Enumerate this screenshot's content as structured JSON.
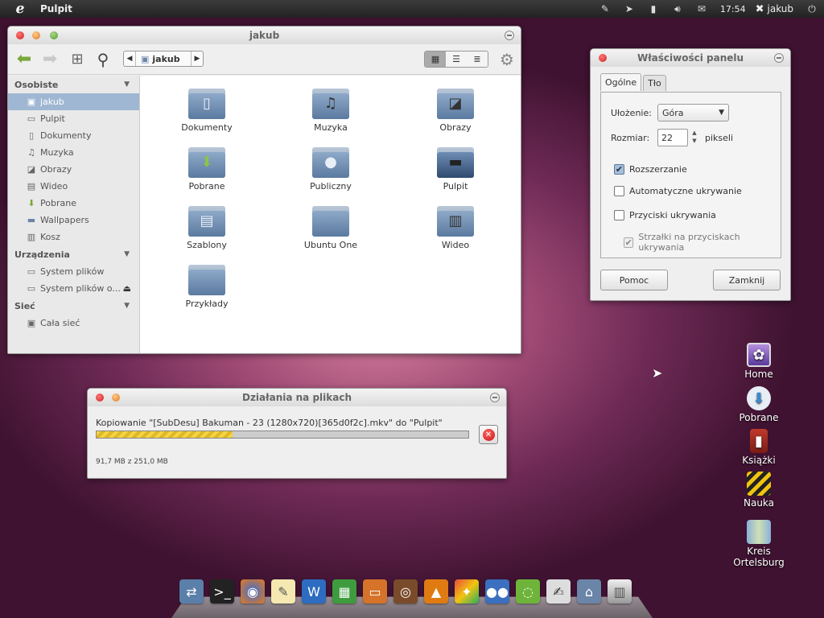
{
  "topbar": {
    "app_name": "Pulpit",
    "clock": "17:54",
    "user": "jakub"
  },
  "file_manager": {
    "title": "jakub",
    "path": {
      "crumb": "jakub"
    },
    "sidebar": {
      "sections": [
        {
          "label": "Osobiste",
          "items": [
            {
              "label": "jakub",
              "icon": "home-folder-icon",
              "selected": true
            },
            {
              "label": "Pulpit",
              "icon": "desktop-icon"
            },
            {
              "label": "Dokumenty",
              "icon": "document-icon"
            },
            {
              "label": "Muzyka",
              "icon": "music-icon"
            },
            {
              "label": "Obrazy",
              "icon": "picture-icon"
            },
            {
              "label": "Wideo",
              "icon": "film-icon"
            },
            {
              "label": "Pobrane",
              "icon": "download-icon"
            },
            {
              "label": "Wallpapers",
              "icon": "folder-icon"
            },
            {
              "label": "Kosz",
              "icon": "trash-icon"
            }
          ]
        },
        {
          "label": "Urządzenia",
          "items": [
            {
              "label": "System plików",
              "icon": "drive-icon"
            },
            {
              "label": "System plików o...",
              "icon": "drive-icon"
            }
          ]
        },
        {
          "label": "Sieć",
          "items": [
            {
              "label": "Cała sieć",
              "icon": "network-icon"
            }
          ]
        }
      ]
    },
    "folders": [
      {
        "label": "Dokumenty",
        "emblem": "document"
      },
      {
        "label": "Muzyka",
        "emblem": "music"
      },
      {
        "label": "Obrazy",
        "emblem": "picture"
      },
      {
        "label": "Pobrane",
        "emblem": "download"
      },
      {
        "label": "Publiczny",
        "emblem": "person"
      },
      {
        "label": "Pulpit",
        "emblem": "desktop"
      },
      {
        "label": "Szablony",
        "emblem": "template"
      },
      {
        "label": "Ubuntu One",
        "emblem": "none"
      },
      {
        "label": "Wideo",
        "emblem": "film"
      },
      {
        "label": "Przykłady",
        "emblem": "none"
      }
    ]
  },
  "panel_dialog": {
    "title": "Właściwości panelu",
    "tabs": [
      "Ogólne",
      "Tło"
    ],
    "placement_label": "Ułożenie:",
    "placement_value": "Góra",
    "size_label": "Rozmiar:",
    "size_value": "22",
    "size_unit": "pikseli",
    "checkboxes": [
      {
        "label": "Rozszerzanie",
        "checked": true,
        "enabled": true
      },
      {
        "label": "Automatyczne ukrywanie",
        "checked": false,
        "enabled": true
      },
      {
        "label": "Przyciski ukrywania",
        "checked": false,
        "enabled": true
      },
      {
        "label": "Strzałki na przyciskach ukrywania",
        "checked": true,
        "enabled": false
      }
    ],
    "help_button": "Pomoc",
    "close_button": "Zamknij"
  },
  "file_ops": {
    "title": "Działania na plikach",
    "message": "Kopiowanie \"[SubDesu] Bakuman - 23 (1280x720)[365d0f2c].mkv\" do \"Pulpit\"",
    "progress": 0.365,
    "progress_text": "91,7 MB z 251,0 MB"
  },
  "desktop_icons": [
    {
      "label": "Home",
      "icon": "monitor-icon"
    },
    {
      "label": "Pobrane",
      "icon": "cloud-download-icon"
    },
    {
      "label": "Książki",
      "icon": "book-icon"
    },
    {
      "label": "Nauka",
      "icon": "barrier-icon"
    },
    {
      "label": "Kreis Ortelsburg",
      "icon": "map-icon"
    }
  ],
  "dock": [
    "network-icon",
    "terminal-icon",
    "firefox-icon",
    "text-editor-icon",
    "writer-icon",
    "calc-icon",
    "impress-icon",
    "speaker-icon",
    "vlc-icon",
    "paint-icon",
    "pidgin-icon",
    "ubuntu-one-icon",
    "gimp-icon",
    "home-folder-icon",
    "trash-icon"
  ],
  "colors": {
    "selection": "#9fb7d2",
    "accent_green": "#7aa83a",
    "progress_fill": "#f3d446"
  }
}
